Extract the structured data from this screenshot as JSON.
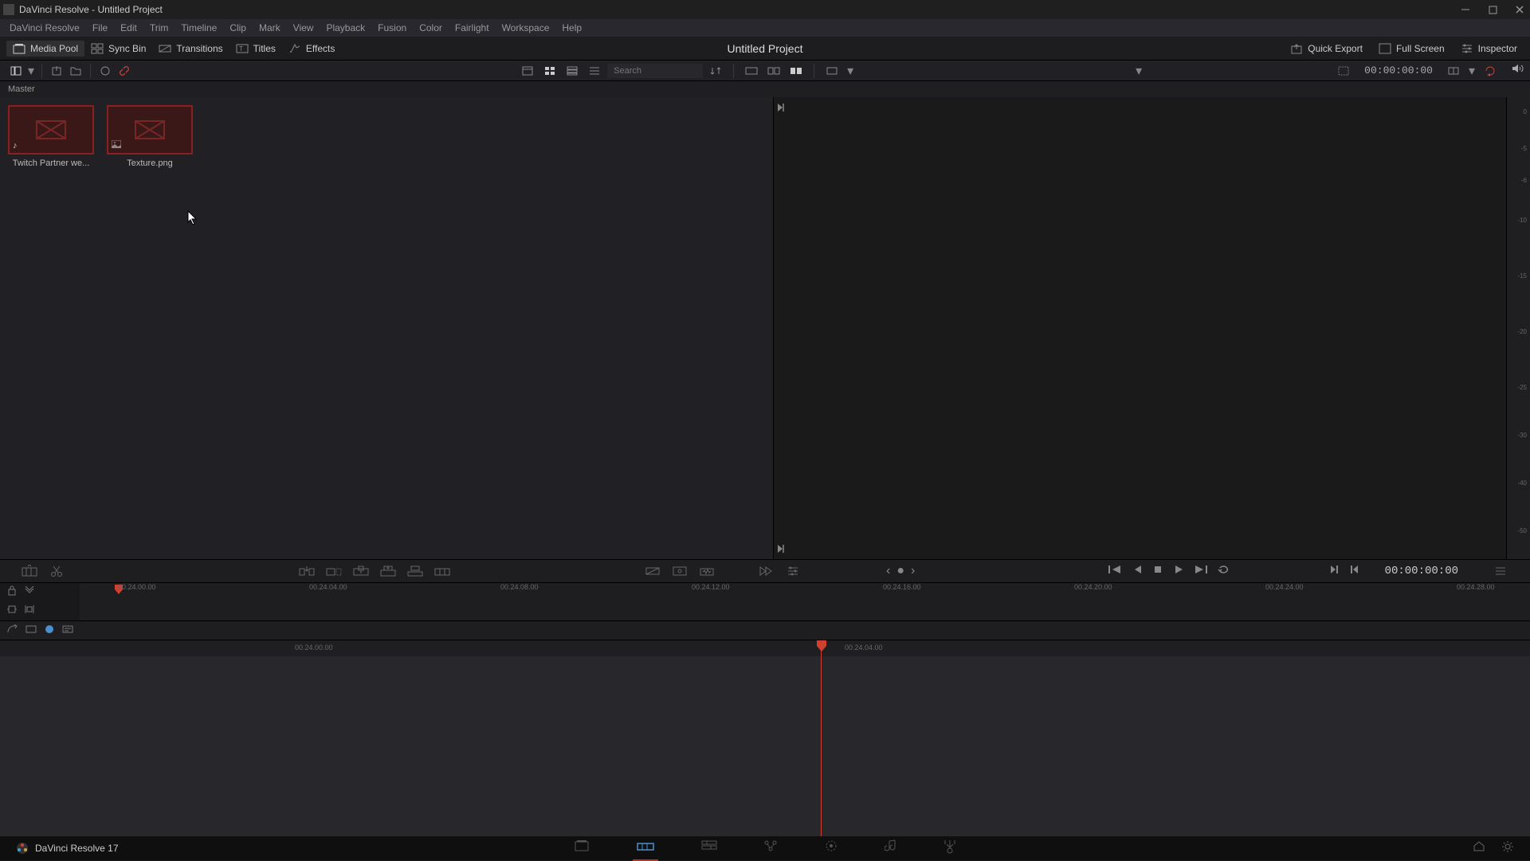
{
  "window": {
    "title": "DaVinci Resolve - Untitled Project"
  },
  "menubar": [
    "DaVinci Resolve",
    "File",
    "Edit",
    "Trim",
    "Timeline",
    "Clip",
    "Mark",
    "View",
    "Playback",
    "Fusion",
    "Color",
    "Fairlight",
    "Workspace",
    "Help"
  ],
  "toolbar": {
    "media_pool": "Media Pool",
    "sync_bin": "Sync Bin",
    "transitions": "Transitions",
    "titles": "Titles",
    "effects": "Effects",
    "project_title": "Untitled Project",
    "quick_export": "Quick Export",
    "full_screen": "Full Screen",
    "inspector": "Inspector"
  },
  "search": {
    "placeholder": "Search"
  },
  "timecode": {
    "main": "00:00:00:00",
    "right": "00:00:00:00"
  },
  "breadcrumb": "Master",
  "clips": [
    {
      "label": "Twitch Partner we...",
      "type": "audio"
    },
    {
      "label": "Texture.png",
      "type": "image"
    }
  ],
  "audio_meter_ticks": [
    "0",
    "-5",
    "-6",
    "-10",
    "-15",
    "-20",
    "-25",
    "-30",
    "-40",
    "-50"
  ],
  "ruler_marks": [
    "00.24.00.00",
    "00.24.04.00",
    "00.24.08.00",
    "00.24.12.00",
    "00.24.16.00",
    "00.24.20.00",
    "00.24.24.00",
    "00.24.28.00"
  ],
  "timeline_marks": [
    "00.24.00.00",
    "00.24.04.00"
  ],
  "bottom": {
    "label": "DaVinci Resolve 17"
  }
}
